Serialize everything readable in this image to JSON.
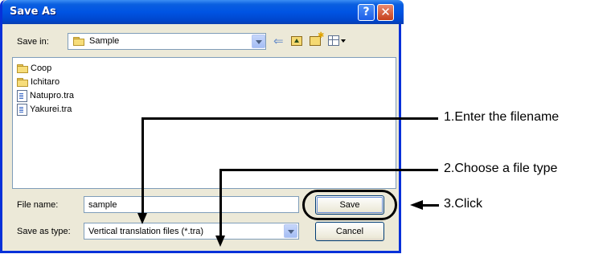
{
  "dialog": {
    "title": "Save As",
    "help_glyph": "?",
    "close_glyph": "✕",
    "save_in_label": "Save in:",
    "save_in_value": "Sample",
    "files": [
      {
        "name": "Coop",
        "icon": "folder-icon"
      },
      {
        "name": "Ichitaro",
        "icon": "folder-icon"
      },
      {
        "name": "Natupro.tra",
        "icon": "document-icon"
      },
      {
        "name": "Yakurei.tra",
        "icon": "document-icon"
      }
    ],
    "file_name_label": "File name:",
    "file_name_value": "sample",
    "save_as_type_label": "Save as type:",
    "save_as_type_value": "Vertical translation files (*.tra)",
    "save_button": "Save",
    "cancel_button": "Cancel"
  },
  "annotations": {
    "step1": "1.Enter the filename",
    "step2": "2.Choose a file type",
    "step3": "3.Click"
  },
  "colors": {
    "titlebar": "#0054e3",
    "dialog_bg": "#ece9d8",
    "field_border": "#7f9db9"
  }
}
